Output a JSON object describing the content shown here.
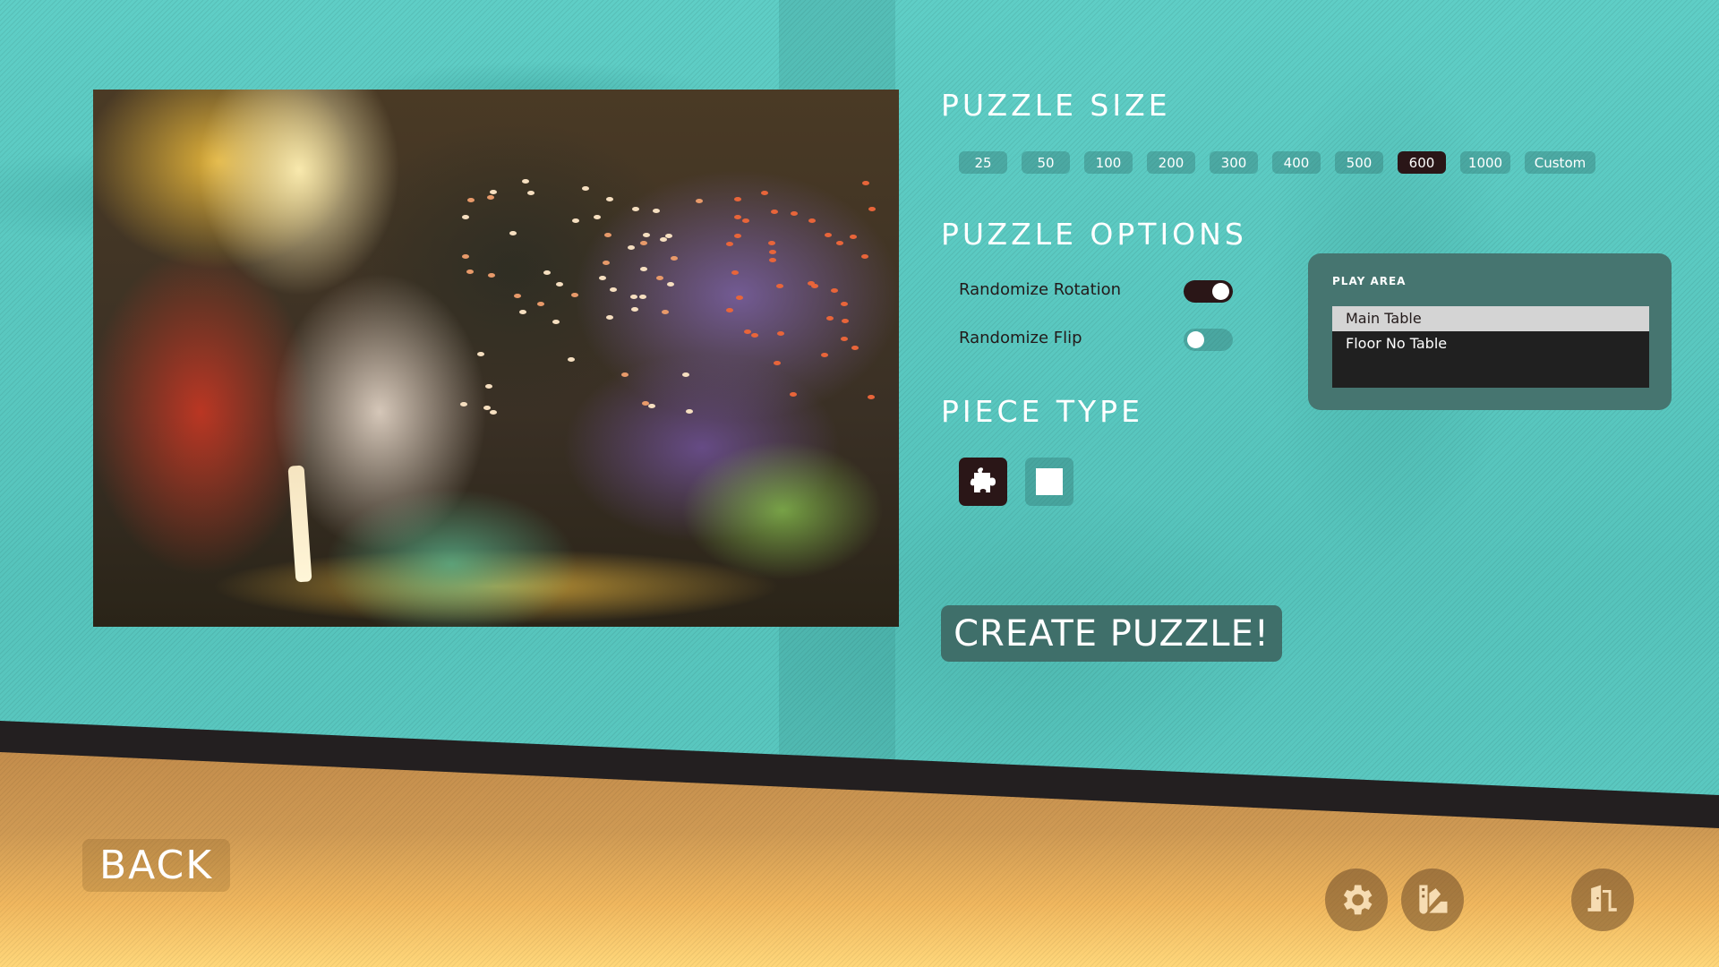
{
  "puzzle_size": {
    "heading": "PUZZLE SIZE",
    "options": [
      "25",
      "50",
      "100",
      "200",
      "300",
      "400",
      "500",
      "600",
      "1000",
      "Custom"
    ],
    "selected": "600"
  },
  "puzzle_options": {
    "heading": "PUZZLE OPTIONS",
    "randomize_rotation": {
      "label": "Randomize Rotation",
      "enabled": true
    },
    "randomize_flip": {
      "label": "Randomize Flip",
      "enabled": false
    }
  },
  "piece_type": {
    "heading": "PIECE TYPE",
    "options": [
      {
        "name": "jigsaw",
        "icon": "jigsaw-piece-icon",
        "selected": true
      },
      {
        "name": "square",
        "icon": "square-piece-icon",
        "selected": false
      }
    ]
  },
  "play_area": {
    "title": "PLAY AREA",
    "options": [
      "Main Table",
      "Floor No Table"
    ],
    "selected": "Main Table"
  },
  "actions": {
    "create_label": "CREATE PUZZLE!",
    "back_label": "BACK"
  },
  "footer_icons": [
    "gear-icon",
    "palette-icon",
    "exit-door-icon"
  ],
  "colors": {
    "teal_background": "#5cc9c1",
    "selected_dark": "#2a1617",
    "panel": "#467570",
    "sand": "#e0a858"
  }
}
